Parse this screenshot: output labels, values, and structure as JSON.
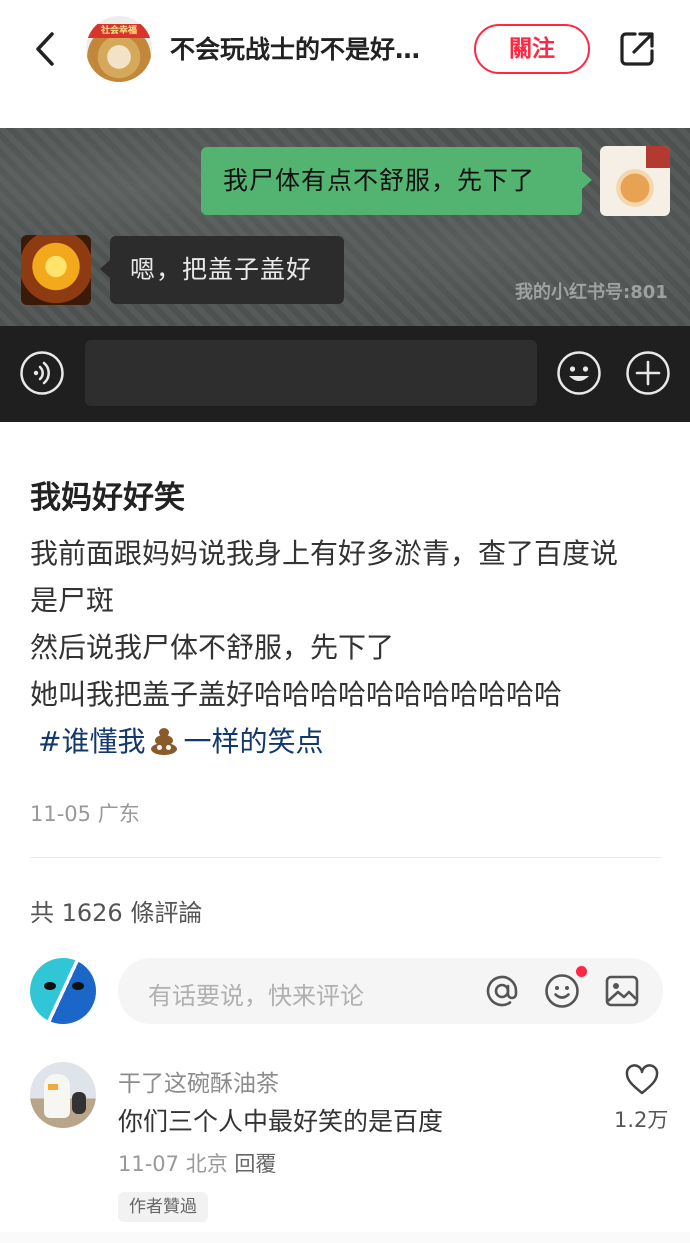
{
  "header": {
    "avatar_banner": "社会幸福",
    "title": "不会玩战士的不是好…",
    "follow_label": "關注"
  },
  "chat_image": {
    "message_right": "我尸体有点不舒服，先下了",
    "message_left": "嗯，把盖子盖好",
    "watermark": "我的小红书号:801"
  },
  "post": {
    "title": "我妈好好笑",
    "body_lines": [
      "我前面跟妈妈说我身上有好多淤青，查了百度说",
      "是尸斑",
      "然后说我尸体不舒服，先下了",
      "她叫我把盖子盖好哈哈哈哈哈哈哈哈哈哈哈"
    ],
    "tag_prefix": "#谁懂我",
    "tag_emoji": "poop",
    "tag_suffix": "一样的笑点",
    "meta": "11-05 广东"
  },
  "comments": {
    "count_label": "共 1626 條評論",
    "input_placeholder": "有话要说，快来评论",
    "items": [
      {
        "user": "干了这碗酥油茶",
        "text": "你们三个人中最好笑的是百度",
        "date_location": "11-07 北京",
        "reply_label": "回覆",
        "badge": "作者贊過",
        "likes": "1.2万"
      }
    ]
  },
  "colors": {
    "accent": "#ff2742",
    "tag_blue": "#13386c",
    "chat_green": "#53b371"
  },
  "icons": [
    "back-arrow-icon",
    "share-icon",
    "voice-icon",
    "emoji-icon",
    "plus-icon",
    "at-icon",
    "smile-icon",
    "image-icon",
    "heart-icon"
  ]
}
